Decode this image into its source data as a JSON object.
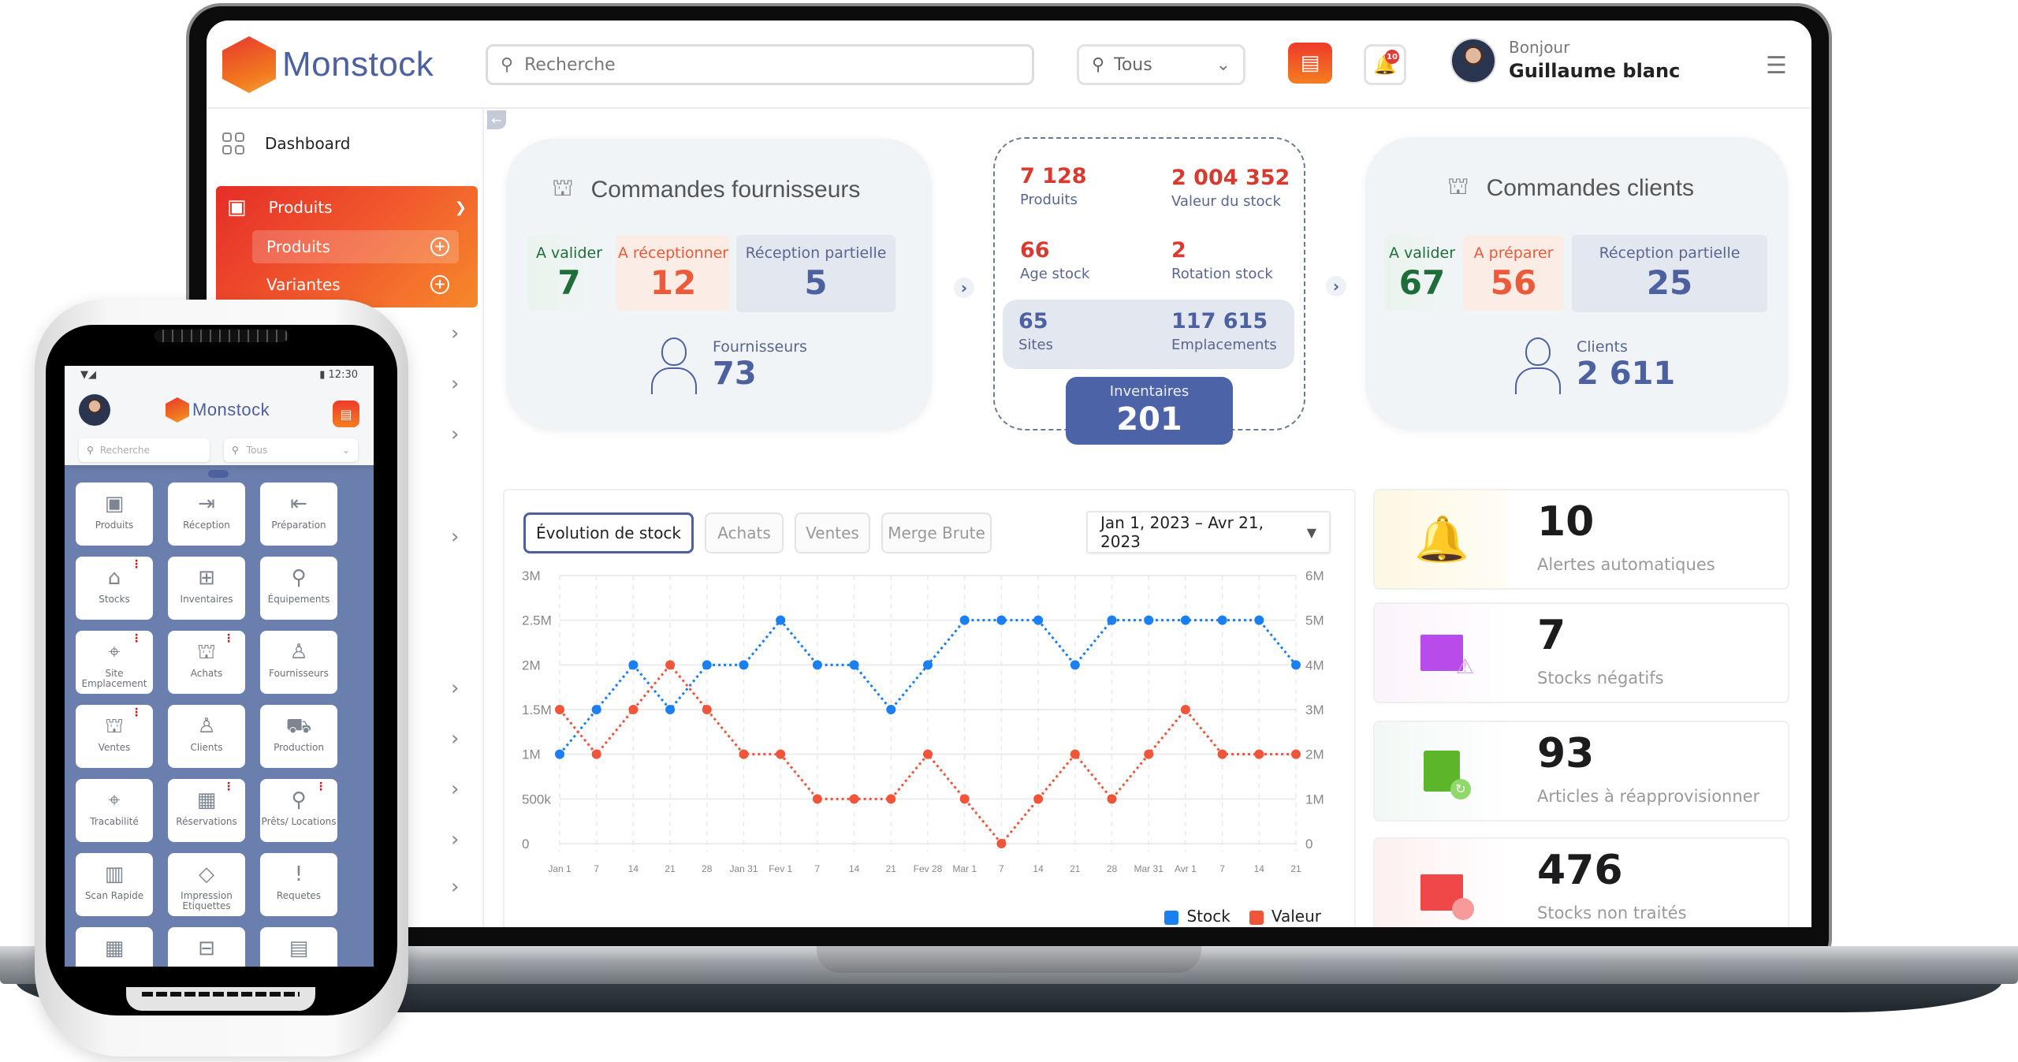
{
  "header": {
    "app_name": "Monstock",
    "search_placeholder": "Recherche",
    "location_value": "Tous",
    "notification_count": "10",
    "greeting": "Bonjour",
    "user_name": "Guillaume blanc"
  },
  "sidebar": {
    "dashboard_label": "Dashboard",
    "active_section": "Produits",
    "sub_items": [
      {
        "label": "Produits"
      },
      {
        "label": "Variantes"
      }
    ]
  },
  "supplier_orders": {
    "title": "Commandes fournisseurs",
    "stats": [
      {
        "label": "A valider",
        "value": "7"
      },
      {
        "label": "A réceptionner",
        "value": "12"
      },
      {
        "label": "Réception partielle",
        "value": "5"
      }
    ],
    "people_label": "Fournisseurs",
    "people_value": "73"
  },
  "stock_summary": {
    "products_value": "7 128",
    "products_label": "Produits",
    "stock_value": "2 004 352",
    "stock_value_label": "Valeur du stock",
    "age_value": "66",
    "age_label": "Age stock",
    "rotation_value": "2",
    "rotation_label": "Rotation stock",
    "sites_value": "65",
    "sites_label": "Sites",
    "locations_value": "117 615",
    "locations_label": "Emplacements",
    "inventories_label": "Inventaires",
    "inventories_value": "201"
  },
  "client_orders": {
    "title": "Commandes clients",
    "stats": [
      {
        "label": "A valider",
        "value": "67"
      },
      {
        "label": "A préparer",
        "value": "56"
      },
      {
        "label": "Réception partielle",
        "value": "25"
      }
    ],
    "people_label": "Clients",
    "people_value": "2 611"
  },
  "chart_tabs": [
    "Évolution de stock",
    "Achats",
    "Ventes",
    "Merge Brute"
  ],
  "date_range": "Jan 1, 2023 – Avr 21, 2023",
  "chart_data": {
    "type": "line",
    "title": "Évolution de stock",
    "x": [
      "Jan 1",
      "7",
      "14",
      "21",
      "28",
      "Jan 31",
      "Fev 1",
      "7",
      "14",
      "21",
      "Fev 28",
      "Mar 1",
      "7",
      "14",
      "21",
      "28",
      "Mar 31",
      "Avr 1",
      "7",
      "14",
      "21"
    ],
    "left_axis": {
      "ticks": [
        "0",
        "500k",
        "1M",
        "1.5M",
        "2M",
        "2.5M",
        "3M"
      ],
      "range": [
        0,
        3000000
      ]
    },
    "right_axis": {
      "ticks": [
        "0",
        "1M",
        "2M",
        "3M",
        "4M",
        "5M",
        "6M"
      ],
      "range": [
        0,
        6000000
      ]
    },
    "series": [
      {
        "name": "Stock",
        "color": "#1a7ff0",
        "axis": "left",
        "values": [
          1000000,
          1500000,
          2000000,
          1500000,
          2000000,
          2000000,
          2500000,
          2000000,
          2000000,
          1500000,
          2000000,
          2500000,
          2500000,
          2500000,
          2000000,
          2500000,
          2500000,
          2500000,
          2500000,
          2500000,
          2000000
        ]
      },
      {
        "name": "Valeur",
        "color": "#f0553a",
        "axis": "right",
        "values": [
          3000000,
          2000000,
          3000000,
          4000000,
          3000000,
          2000000,
          2000000,
          1000000,
          1000000,
          1000000,
          2000000,
          1000000,
          0,
          1000000,
          2000000,
          1000000,
          2000000,
          3000000,
          2000000,
          2000000,
          2000000
        ]
      }
    ],
    "grid": true,
    "legend": "bottom-right"
  },
  "alerts": [
    {
      "value": "10",
      "label": "Alertes automatiques",
      "icon": "bell-icon",
      "color": "#f2b40c"
    },
    {
      "value": "7",
      "label": "Stocks négatifs",
      "icon": "box-warning-icon",
      "color": "#b84bea"
    },
    {
      "value": "93",
      "label": "Articles à réapprovisionner",
      "icon": "document-refresh-icon",
      "color": "#5db52a"
    },
    {
      "value": "476",
      "label": "Stocks non traités",
      "icon": "box-timer-icon",
      "color": "#f04848"
    }
  ],
  "phone": {
    "time": "12:30",
    "app_name": "Monstock",
    "search_placeholder": "Recherche",
    "location_value": "Tous",
    "tiles": [
      {
        "label": "Produits",
        "icon": "▣",
        "dots": false
      },
      {
        "label": "Réception",
        "icon": "⇥",
        "dots": false
      },
      {
        "label": "Préparation",
        "icon": "⇤",
        "dots": false
      },
      {
        "label": "Stocks",
        "icon": "⌂",
        "dots": true
      },
      {
        "label": "Inventaires",
        "icon": "⊞",
        "dots": false
      },
      {
        "label": "Équipements",
        "icon": "⚲",
        "dots": false
      },
      {
        "label": "Site Emplacement",
        "icon": "⌖",
        "dots": true
      },
      {
        "label": "Achats",
        "icon": "⛫",
        "dots": true
      },
      {
        "label": "Fournisseurs",
        "icon": "♙",
        "dots": false
      },
      {
        "label": "Ventes",
        "icon": "⛫",
        "dots": true
      },
      {
        "label": "Clients",
        "icon": "♙",
        "dots": false
      },
      {
        "label": "Production",
        "icon": "⛟",
        "dots": false
      },
      {
        "label": "Tracabilité",
        "icon": "⌖",
        "dots": false
      },
      {
        "label": "Réservations",
        "icon": "▦",
        "dots": true
      },
      {
        "label": "Prêts/ Locations",
        "icon": "⚲",
        "dots": true
      },
      {
        "label": "Scan Rapide",
        "icon": "▥",
        "dots": false
      },
      {
        "label": "Impression Etiquettes",
        "icon": "◇",
        "dots": false
      },
      {
        "label": "Requetes",
        "icon": "!",
        "dots": false
      },
      {
        "label": "",
        "icon": "▦",
        "dots": false
      },
      {
        "label": "",
        "icon": "⊟",
        "dots": false
      },
      {
        "label": "",
        "icon": "▤",
        "dots": false
      }
    ]
  }
}
